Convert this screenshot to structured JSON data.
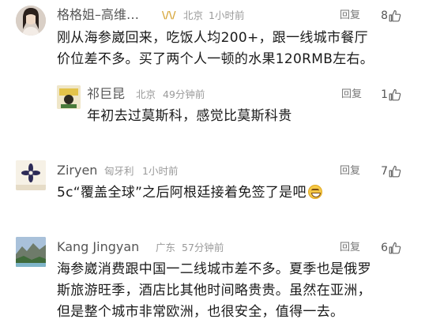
{
  "comments": [
    {
      "name": "格格姐–高维…",
      "badge": "\\/\\/",
      "location": "北京",
      "time": "1小时前",
      "reply_label": "回复",
      "likes": "8",
      "lines": [
        "刚从海参崴回来，吃饭人均200+，跟一线城市餐厅",
        "价位差不多。买了两个人一顿的水果120RMB左右。"
      ]
    },
    {
      "name": "祁巨昆",
      "location": "北京",
      "time": "49分钟前",
      "reply_label": "回复",
      "likes": "1",
      "lines": [
        "年初去过莫斯科，感觉比莫斯科贵"
      ]
    },
    {
      "name": "Ziryen",
      "location": "匈牙利",
      "time": "1小时前",
      "reply_label": "回复",
      "likes": "7",
      "lines": [
        "5c“覆盖全球”之后阿根廷接着免签了是吧"
      ]
    },
    {
      "name": "Kang Jingyan",
      "location": "广东",
      "time": "57分钟前",
      "reply_label": "回复",
      "likes": "6",
      "lines": [
        "海参崴消费跟中国一二线城市差不多。夏季也是俄罗",
        "斯旅游旺季，酒店比其他时间略贵贵。虽然在亚洲，",
        "但是整个城市非常欧洲，也很安全，值得一去。"
      ]
    }
  ],
  "icons": {
    "like": "thumbs-up-icon",
    "emoji": "grinning-face-icon"
  }
}
